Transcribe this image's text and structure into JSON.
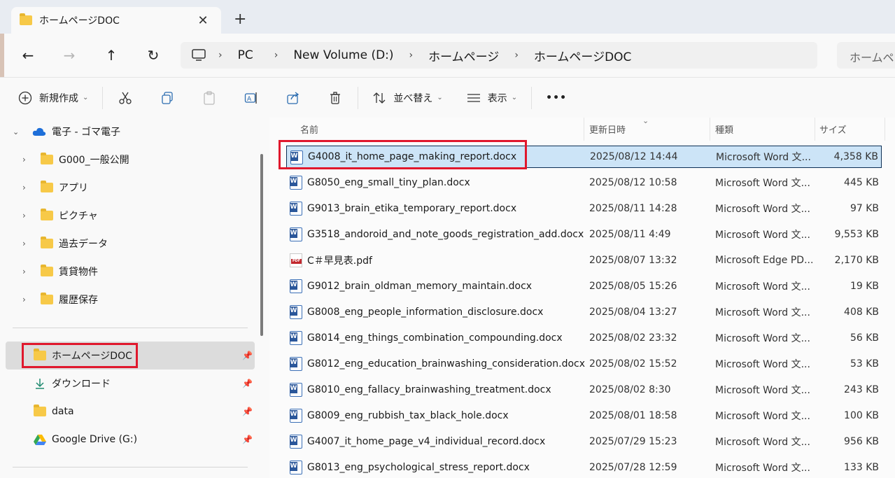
{
  "tab": {
    "title": "ホームページDOC",
    "close": "✕",
    "new": "+"
  },
  "nav": {
    "back": "←",
    "forward": "→",
    "up": "↑",
    "refresh": "↻"
  },
  "address": {
    "segments": [
      "PC",
      "New Volume (D:)",
      "ホームページ",
      "ホームページDOC"
    ],
    "separator": "›"
  },
  "search": {
    "placeholder": "ホームページ"
  },
  "toolbar": {
    "new_label": "新規作成",
    "sort_label": "並べ替え",
    "view_label": "表示",
    "more": "•••"
  },
  "sidebar": {
    "account": "電子 - ゴマ電子",
    "folders": [
      "G000_一般公開",
      "アプリ",
      "ピクチャ",
      "過去データ",
      "賃貸物件",
      "履歴保存"
    ],
    "pinned": [
      "ホームページDOC",
      "ダウンロード",
      "data",
      "Google Drive (G:)"
    ]
  },
  "columns": {
    "name": "名前",
    "date": "更新日時",
    "type": "種類",
    "size": "サイズ"
  },
  "files": [
    {
      "name": "G4008_it_home_page_making_report.docx",
      "date": "2025/08/12 14:44",
      "type": "Microsoft Word 文...",
      "size": "4,358 KB",
      "icon": "word"
    },
    {
      "name": "G8050_eng_small_tiny_plan.docx",
      "date": "2025/08/12 10:58",
      "type": "Microsoft Word 文...",
      "size": "445 KB",
      "icon": "word"
    },
    {
      "name": "G9013_brain_etika_temporary_report.docx",
      "date": "2025/08/11 14:28",
      "type": "Microsoft Word 文...",
      "size": "97 KB",
      "icon": "word"
    },
    {
      "name": "G3518_andoroid_and_note_goods_registration_add.docx",
      "date": "2025/08/11 4:49",
      "type": "Microsoft Word 文...",
      "size": "9,553 KB",
      "icon": "word"
    },
    {
      "name": "C＃早見表.pdf",
      "date": "2025/08/07 13:32",
      "type": "Microsoft Edge PD...",
      "size": "2,170 KB",
      "icon": "pdf"
    },
    {
      "name": "G9012_brain_oldman_memory_maintain.docx",
      "date": "2025/08/05 15:26",
      "type": "Microsoft Word 文...",
      "size": "19 KB",
      "icon": "word"
    },
    {
      "name": "G8008_eng_people_information_disclosure.docx",
      "date": "2025/08/04 13:27",
      "type": "Microsoft Word 文...",
      "size": "408 KB",
      "icon": "word"
    },
    {
      "name": "G8014_eng_things_combination_compounding.docx",
      "date": "2025/08/02 23:32",
      "type": "Microsoft Word 文...",
      "size": "56 KB",
      "icon": "word"
    },
    {
      "name": "G8012_eng_education_brainwashing_consideration.docx",
      "date": "2025/08/02 15:52",
      "type": "Microsoft Word 文...",
      "size": "53 KB",
      "icon": "word"
    },
    {
      "name": "G8010_eng_fallacy_brainwashing_treatment.docx",
      "date": "2025/08/02 8:30",
      "type": "Microsoft Word 文...",
      "size": "243 KB",
      "icon": "word"
    },
    {
      "name": "G8009_eng_rubbish_tax_black_hole.docx",
      "date": "2025/08/01 18:58",
      "type": "Microsoft Word 文...",
      "size": "100 KB",
      "icon": "word"
    },
    {
      "name": "G4007_it_home_page_v4_individual_record.docx",
      "date": "2025/07/29 15:23",
      "type": "Microsoft Word 文...",
      "size": "956 KB",
      "icon": "word"
    },
    {
      "name": "G8013_eng_psychological_stress_report.docx",
      "date": "2025/07/28 12:59",
      "type": "Microsoft Word 文...",
      "size": "133 KB",
      "icon": "word"
    }
  ],
  "colors": {
    "selection": "#cce4f7",
    "highlight_box": "#e0182d",
    "folder": "#f7c948"
  }
}
